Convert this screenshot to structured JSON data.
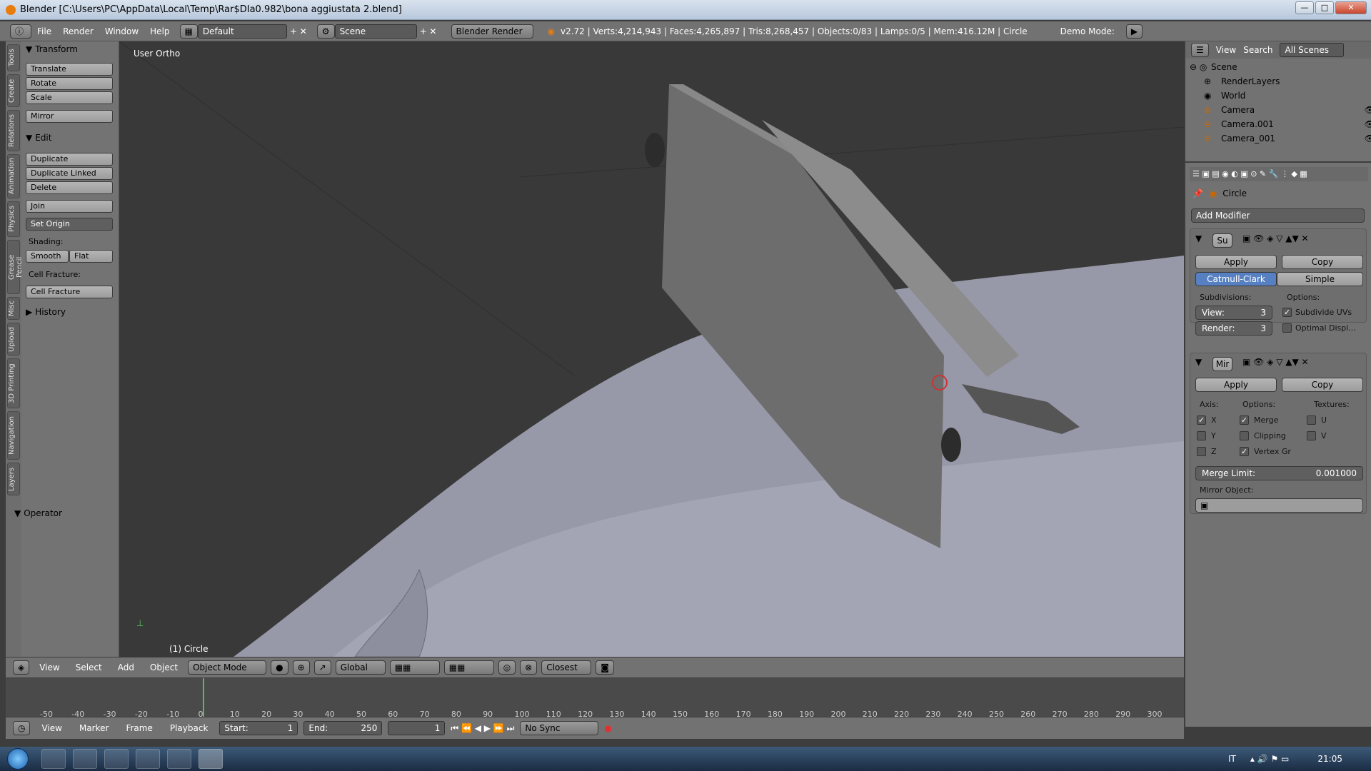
{
  "window": {
    "title": "Blender [C:\\Users\\PC\\AppData\\Local\\Temp\\Rar$DIa0.982\\bona aggiustata 2.blend]"
  },
  "topbar": {
    "menus": [
      "File",
      "Render",
      "Window",
      "Help"
    ],
    "layout": "Default",
    "scene": "Scene",
    "engine": "Blender Render",
    "stats": "v2.72 | Verts:4,214,943 | Faces:4,265,897 | Tris:8,268,457 | Objects:0/83 | Lamps:0/5 | Mem:416.12M | Circle",
    "demo_mode": "Demo Mode:"
  },
  "tabs": [
    "Tools",
    "Create",
    "Relations",
    "Animation",
    "Physics",
    "Grease Pencil",
    "Misc",
    "Upload",
    "3D Printing",
    "Navigation",
    "Layers"
  ],
  "toolshelf": {
    "transform": "Transform",
    "translate": "Translate",
    "rotate": "Rotate",
    "scale": "Scale",
    "mirror": "Mirror",
    "edit": "Edit",
    "duplicate": "Duplicate",
    "duplicate_linked": "Duplicate Linked",
    "delete": "Delete",
    "join": "Join",
    "set_origin": "Set Origin",
    "shading": "Shading:",
    "smooth": "Smooth",
    "flat": "Flat",
    "cell_fracture_label": "Cell Fracture:",
    "cell_fracture": "Cell Fracture",
    "history": "History",
    "operator": "Operator"
  },
  "viewport": {
    "view_name": "User Ortho",
    "object_label": "(1) Circle"
  },
  "view_header": {
    "view": "View",
    "select": "Select",
    "add": "Add",
    "object": "Object",
    "mode": "Object Mode",
    "orientation": "Global",
    "snap": "Closest"
  },
  "timeline": {
    "ticks": [
      "-50",
      "-40",
      "-30",
      "-20",
      "-10",
      "0",
      "10",
      "20",
      "30",
      "40",
      "50",
      "60",
      "70",
      "80",
      "90",
      "100",
      "110",
      "120",
      "130",
      "140",
      "150",
      "160",
      "170",
      "180",
      "190",
      "200",
      "210",
      "220",
      "230",
      "240",
      "250",
      "260",
      "270",
      "280",
      "290",
      "300"
    ],
    "view": "View",
    "marker": "Marker",
    "frame": "Frame",
    "playback": "Playback",
    "start": "Start:",
    "start_val": "1",
    "end": "End:",
    "end_val": "250",
    "current": "1",
    "sync": "No Sync"
  },
  "outliner": {
    "view": "View",
    "search": "Search",
    "filter": "All Scenes",
    "items": [
      "Scene",
      "RenderLayers",
      "World",
      "Camera",
      "Camera.001",
      "Camera_001"
    ]
  },
  "properties": {
    "object_name": "Circle",
    "add_modifier": "Add Modifier",
    "mod1_name": "Su",
    "apply": "Apply",
    "copy": "Copy",
    "catmull": "Catmull-Clark",
    "simple": "Simple",
    "subdivisions": "Subdivisions:",
    "options": "Options:",
    "view": "View:",
    "view_val": "3",
    "render": "Render:",
    "render_val": "3",
    "subdivide_uvs": "Subdivide UVs",
    "optimal_disp": "Optimal Displ...",
    "mod2_name": "Mir",
    "axis": "Axis:",
    "textures": "Textures:",
    "x": "X",
    "y": "Y",
    "z": "Z",
    "merge": "Merge",
    "clipping": "Clipping",
    "vertex_gr": "Vertex Gr",
    "u": "U",
    "v": "V",
    "merge_limit": "Merge Limit:",
    "merge_limit_val": "0.001000",
    "mirror_object": "Mirror Object:"
  },
  "taskbar": {
    "lang": "IT",
    "time": "21:05"
  },
  "colors": {
    "accent": "#5680c2",
    "viewport": "#393939",
    "panel": "#737373"
  }
}
